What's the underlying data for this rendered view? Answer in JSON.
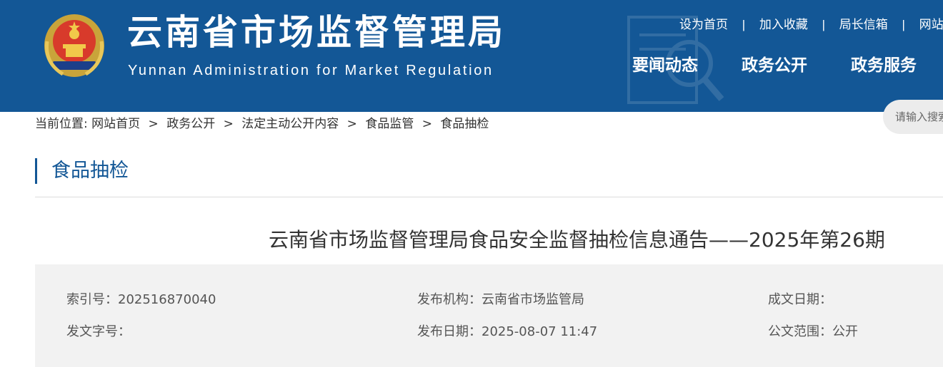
{
  "header": {
    "title": "云南省市场监督管理局",
    "subtitle": "Yunnan Administration for Market Regulation",
    "top_links": [
      "设为首页",
      "加入收藏",
      "局长信箱",
      "网站"
    ],
    "top_link_separator": "|",
    "nav": [
      "要闻动态",
      "政务公开",
      "政务服务"
    ]
  },
  "search": {
    "placeholder": "请输入搜索"
  },
  "breadcrumb": {
    "prefix": "当前位置: ",
    "items": [
      "网站首页",
      "政务公开",
      "法定主动公开内容",
      "食品监管",
      "食品抽检"
    ],
    "separator": ">"
  },
  "section": {
    "title": "食品抽检"
  },
  "article": {
    "title": "云南省市场监督管理局食品安全监督抽检信息通告——2025年第26期"
  },
  "meta": {
    "index_no": {
      "label": "索引号：",
      "value": "202516870040"
    },
    "publisher": {
      "label": "发布机构：",
      "value": "云南省市场监管局"
    },
    "written_date": {
      "label": "成文日期：",
      "value": ""
    },
    "doc_no": {
      "label": "发文字号：",
      "value": ""
    },
    "publish_date": {
      "label": "发布日期：",
      "value": "2025-08-07 11:47"
    },
    "scope": {
      "label": "公文范围：",
      "value": "公开"
    }
  },
  "colors": {
    "header_bg": "#135796",
    "accent": "#135796",
    "meta_bg": "#f2f2f2"
  },
  "icons": [
    "national-emblem-icon"
  ]
}
